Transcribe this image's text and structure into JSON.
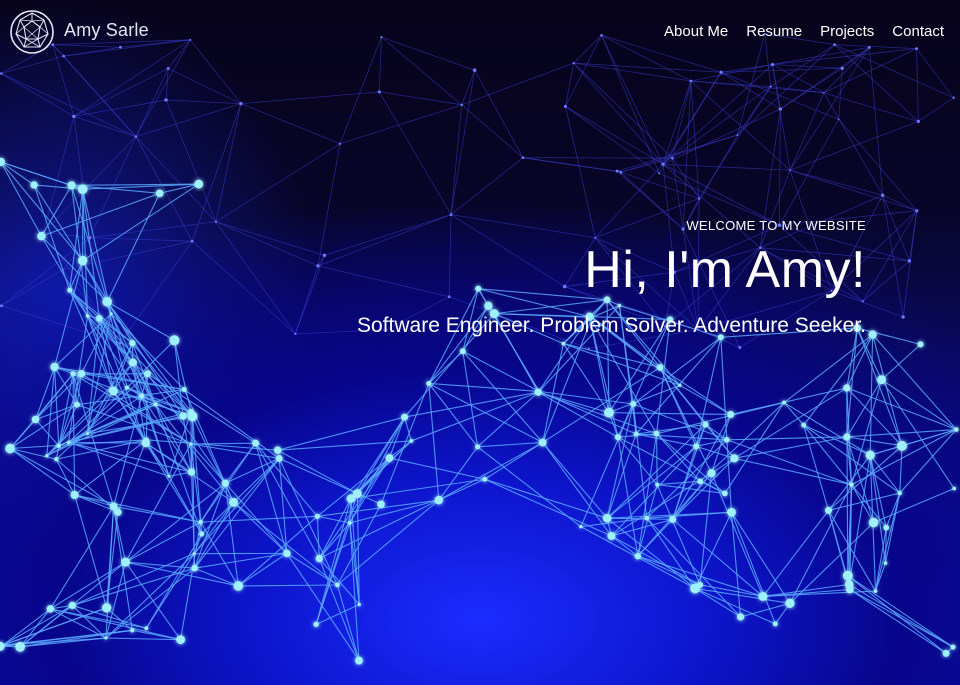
{
  "brand": {
    "name": "Amy Sarle",
    "logo_icon": "geodesic-globe-icon"
  },
  "nav": {
    "items": [
      {
        "label": "About Me"
      },
      {
        "label": "Resume"
      },
      {
        "label": "Projects"
      },
      {
        "label": "Contact"
      }
    ]
  },
  "hero": {
    "welcome": "WELCOME TO MY WEBSITE",
    "greeting": "Hi, I'm Amy!",
    "tagline": "Software Engineer. Problem Solver. Adventure Seeker."
  },
  "colors": {
    "background_dark": "#07041f",
    "network_blue": "#1a2cff",
    "node_glow": "#8fe6ff",
    "text": "#ffffff"
  }
}
